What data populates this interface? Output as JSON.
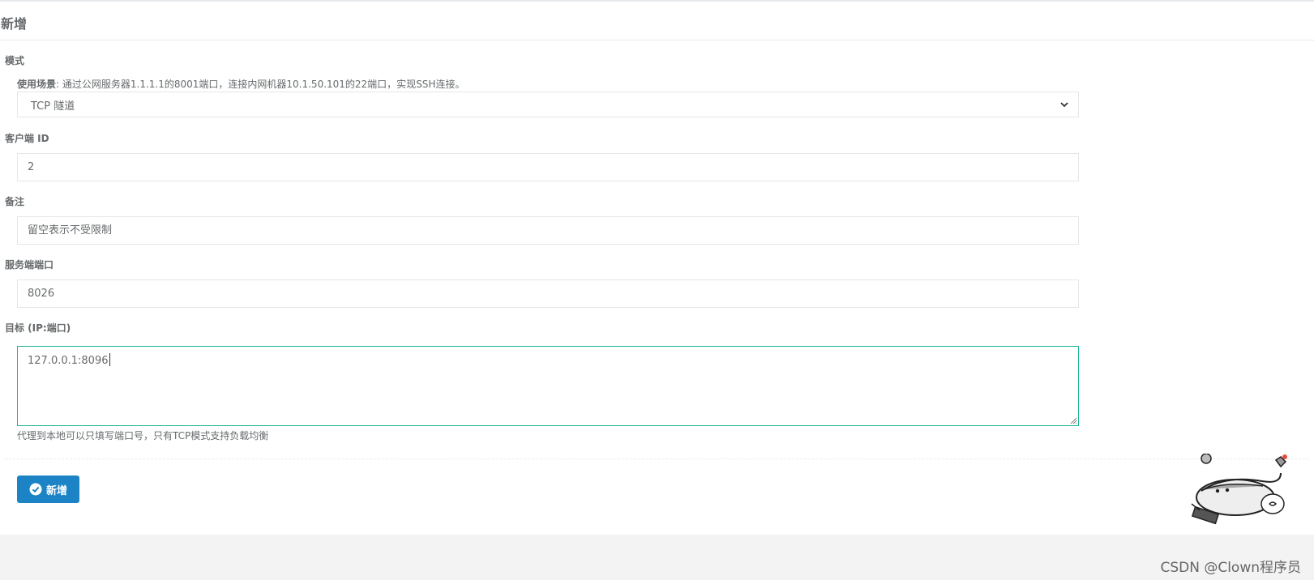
{
  "form": {
    "title": "新增",
    "mode": {
      "label": "模式",
      "hint_label": "使用场景",
      "hint_text": ": 通过公网服务器1.1.1.1的8001端口，连接内网机器10.1.50.101的22端口，实现SSH连接。",
      "selected": "TCP 隧道"
    },
    "client_id": {
      "label": "客户端 ID",
      "value": "2"
    },
    "remark": {
      "label": "备注",
      "placeholder": "留空表示不受限制"
    },
    "server_port": {
      "label": "服务端端口",
      "value": "8026"
    },
    "target": {
      "label": "目标 (IP:端口)",
      "value": "127.0.0.1:8096",
      "help": "代理到本地可以只填写端口号，只有TCP模式支持负载均衡"
    },
    "submit_label": "新增"
  },
  "watermark": "CSDN @Clown程序员",
  "colors": {
    "primary": "#1c84c6",
    "focus_border": "#1ab394",
    "text": "#676a6c"
  },
  "icons": {
    "select_arrow": "chevron-down-icon",
    "submit": "check-circle-icon"
  }
}
